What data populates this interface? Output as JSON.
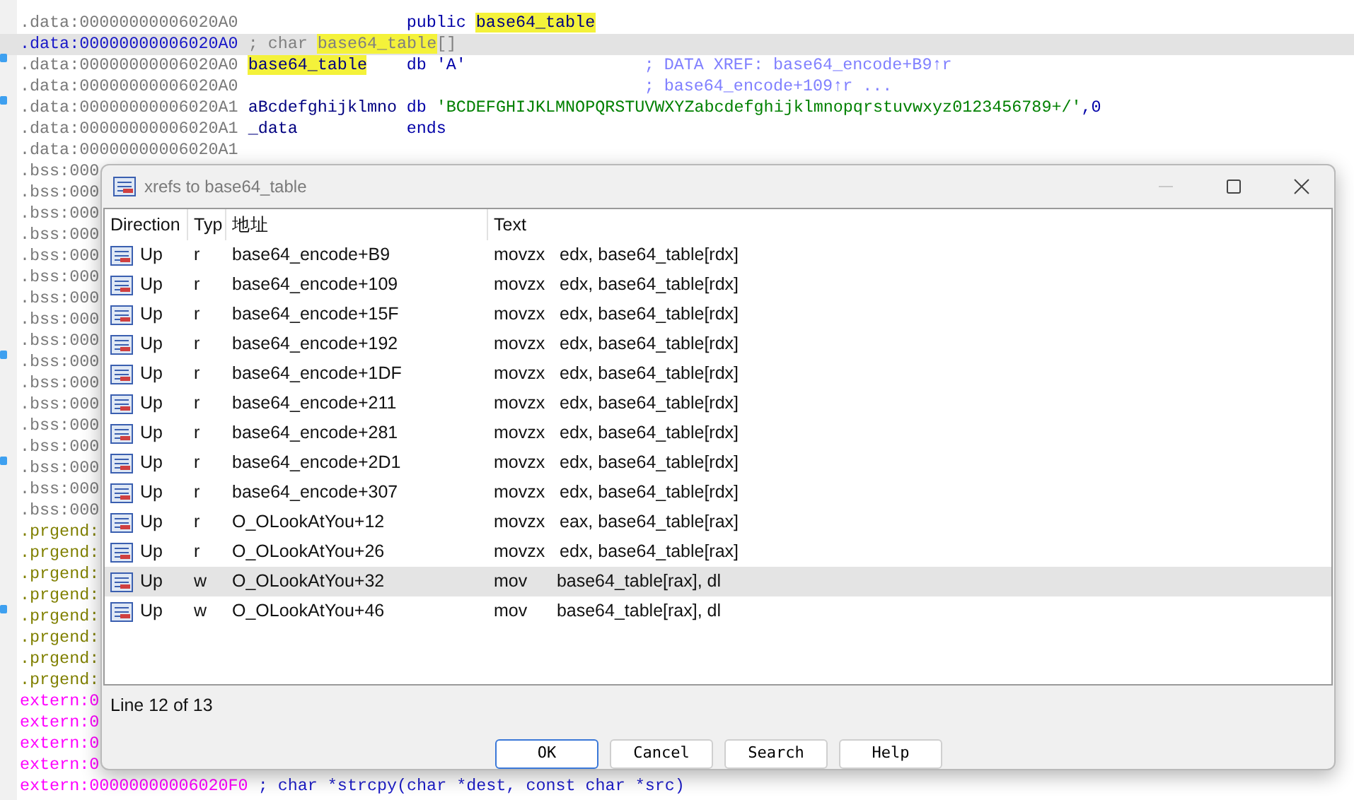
{
  "listing": {
    "lines": [
      {
        "address": ".data:00000000006020A0",
        "kind": "data",
        "selected": false,
        "marked": false,
        "code": [
          {
            "text": "public ",
            "kind": "keyword",
            "highlighted": false
          },
          {
            "text": "base64_table",
            "kind": "name",
            "highlighted": true
          }
        ]
      },
      {
        "address": ".data:00000000006020A0",
        "kind": "data",
        "selected": true,
        "marked": false,
        "label": [
          {
            "text": "; char ",
            "kind": "comment",
            "highlighted": false
          },
          {
            "text": "base64_table",
            "kind": "comment",
            "highlighted": true
          },
          {
            "text": "[]",
            "kind": "comment",
            "highlighted": false
          }
        ]
      },
      {
        "address": ".data:00000000006020A0",
        "kind": "data",
        "selected": false,
        "marked": true,
        "label": [
          {
            "text": "base64_table",
            "kind": "name",
            "highlighted": true
          }
        ],
        "code": [
          {
            "text": "db 'A'",
            "kind": "keyword",
            "highlighted": false
          }
        ],
        "comment": "; DATA XREF: base64_encode+B9↑r"
      },
      {
        "address": ".data:00000000006020A0",
        "kind": "data",
        "selected": false,
        "marked": false,
        "comment": "; base64_encode+109↑r ..."
      },
      {
        "address": ".data:00000000006020A1",
        "kind": "data",
        "selected": false,
        "marked": true,
        "label": [
          {
            "text": "aBcdefghijklmno",
            "kind": "name",
            "highlighted": false
          }
        ],
        "code": [
          {
            "text": "db ",
            "kind": "keyword",
            "highlighted": false
          },
          {
            "text": "'BCDEFGHIJKLMNOPQRSTUVWXYZabcdefghijklmnopqrstuvwxyz0123456789+/'",
            "kind": "string",
            "highlighted": false
          },
          {
            "text": ",0",
            "kind": "keyword",
            "highlighted": false
          }
        ]
      },
      {
        "address": ".data:00000000006020A1",
        "kind": "data",
        "selected": false,
        "marked": false,
        "label": [
          {
            "text": "_data",
            "kind": "name",
            "highlighted": false
          }
        ],
        "code": [
          {
            "text": "ends",
            "kind": "keyword",
            "highlighted": false
          }
        ]
      },
      {
        "address": ".data:00000000006020A1",
        "kind": "data",
        "selected": false,
        "marked": false
      },
      {
        "address": ".bss:000",
        "kind": "bss",
        "selected": false,
        "marked": false
      },
      {
        "address": ".bss:000",
        "kind": "bss",
        "selected": false,
        "marked": false
      },
      {
        "address": ".bss:000",
        "kind": "bss",
        "selected": false,
        "marked": false
      },
      {
        "address": ".bss:000",
        "kind": "bss",
        "selected": false,
        "marked": false
      },
      {
        "address": ".bss:000",
        "kind": "bss",
        "selected": false,
        "marked": false
      },
      {
        "address": ".bss:000",
        "kind": "bss",
        "selected": false,
        "marked": false
      },
      {
        "address": ".bss:000",
        "kind": "bss",
        "selected": false,
        "marked": false
      },
      {
        "address": ".bss:000",
        "kind": "bss",
        "selected": false,
        "marked": false
      },
      {
        "address": ".bss:000",
        "kind": "bss",
        "selected": false,
        "marked": false
      },
      {
        "address": ".bss:000",
        "kind": "bss",
        "selected": false,
        "marked": true
      },
      {
        "address": ".bss:000",
        "kind": "bss",
        "selected": false,
        "marked": false
      },
      {
        "address": ".bss:000",
        "kind": "bss",
        "selected": false,
        "marked": false
      },
      {
        "address": ".bss:000",
        "kind": "bss",
        "selected": false,
        "marked": false
      },
      {
        "address": ".bss:000",
        "kind": "bss",
        "selected": false,
        "marked": false
      },
      {
        "address": ".bss:000",
        "kind": "bss",
        "selected": false,
        "marked": true
      },
      {
        "address": ".bss:000",
        "kind": "bss",
        "selected": false,
        "marked": false
      },
      {
        "address": ".bss:000",
        "kind": "bss",
        "selected": false,
        "marked": false
      },
      {
        "address": ".prgend:",
        "kind": "prgend",
        "selected": false,
        "marked": false
      },
      {
        "address": ".prgend:",
        "kind": "prgend",
        "selected": false,
        "marked": false
      },
      {
        "address": ".prgend:",
        "kind": "prgend",
        "selected": false,
        "marked": false
      },
      {
        "address": ".prgend:",
        "kind": "prgend",
        "selected": false,
        "marked": false
      },
      {
        "address": ".prgend:",
        "kind": "prgend",
        "selected": false,
        "marked": true
      },
      {
        "address": ".prgend:",
        "kind": "prgend",
        "selected": false,
        "marked": false
      },
      {
        "address": ".prgend:",
        "kind": "prgend",
        "selected": false,
        "marked": false
      },
      {
        "address": ".prgend:",
        "kind": "prgend",
        "selected": false,
        "marked": false
      },
      {
        "address": "extern:0",
        "kind": "extern",
        "selected": false,
        "marked": false
      },
      {
        "address": "extern:0",
        "kind": "extern",
        "selected": false,
        "marked": false
      },
      {
        "address": "extern:0",
        "kind": "extern",
        "selected": false,
        "marked": false
      },
      {
        "address": "extern:0",
        "kind": "extern",
        "selected": false,
        "marked": false
      },
      {
        "address": "extern:00000000006020F0",
        "kind": "extern",
        "selected": false,
        "marked": false,
        "label": [
          {
            "text": "; char *strcpy(char *dest, const char *src)",
            "kind": "declaration",
            "highlighted": false
          }
        ]
      }
    ]
  },
  "dialog": {
    "title": "xrefs to base64_table",
    "columns": [
      "Direction",
      "Typ",
      "地址",
      "Text"
    ],
    "rows": [
      {
        "direction": "Up",
        "type": "r",
        "address": "base64_encode+B9",
        "text": "movzx   edx, base64_table[rdx]",
        "selected": false
      },
      {
        "direction": "Up",
        "type": "r",
        "address": "base64_encode+109",
        "text": "movzx   edx, base64_table[rdx]",
        "selected": false
      },
      {
        "direction": "Up",
        "type": "r",
        "address": "base64_encode+15F",
        "text": "movzx   edx, base64_table[rdx]",
        "selected": false
      },
      {
        "direction": "Up",
        "type": "r",
        "address": "base64_encode+192",
        "text": "movzx   edx, base64_table[rdx]",
        "selected": false
      },
      {
        "direction": "Up",
        "type": "r",
        "address": "base64_encode+1DF",
        "text": "movzx   edx, base64_table[rdx]",
        "selected": false
      },
      {
        "direction": "Up",
        "type": "r",
        "address": "base64_encode+211",
        "text": "movzx   edx, base64_table[rdx]",
        "selected": false
      },
      {
        "direction": "Up",
        "type": "r",
        "address": "base64_encode+281",
        "text": "movzx   edx, base64_table[rdx]",
        "selected": false
      },
      {
        "direction": "Up",
        "type": "r",
        "address": "base64_encode+2D1",
        "text": "movzx   edx, base64_table[rdx]",
        "selected": false
      },
      {
        "direction": "Up",
        "type": "r",
        "address": "base64_encode+307",
        "text": "movzx   edx, base64_table[rdx]",
        "selected": false
      },
      {
        "direction": "Up",
        "type": "r",
        "address": "O_OLookAtYou+12",
        "text": "movzx   eax, base64_table[rax]",
        "selected": false
      },
      {
        "direction": "Up",
        "type": "r",
        "address": "O_OLookAtYou+26",
        "text": "movzx   edx, base64_table[rax]",
        "selected": false
      },
      {
        "direction": "Up",
        "type": "w",
        "address": "O_OLookAtYou+32",
        "text": "mov      base64_table[rax], dl",
        "selected": true
      },
      {
        "direction": "Up",
        "type": "w",
        "address": "O_OLookAtYou+46",
        "text": "mov      base64_table[rax], dl",
        "selected": false
      }
    ],
    "status": "Line 12 of 13",
    "buttons": [
      {
        "label": "OK",
        "default": true
      },
      {
        "label": "Cancel",
        "default": false
      },
      {
        "label": "Search",
        "default": false
      },
      {
        "label": "Help",
        "default": false
      }
    ]
  }
}
